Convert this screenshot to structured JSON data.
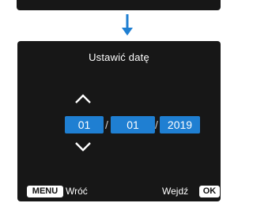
{
  "colors": {
    "screen_bg": "#171717",
    "accent": "#1f7fd2",
    "arrow": "#1f7fd2"
  },
  "icons": {
    "flow_arrow": "arrow-down-icon",
    "increase": "chevron-up-icon",
    "decrease": "chevron-down-icon"
  },
  "screen": {
    "title": "Ustawić datę",
    "date": {
      "day": "01",
      "month": "01",
      "year": "2019",
      "separator": "/"
    },
    "footer": {
      "menu_key": "MENU",
      "menu_label": "Wróć",
      "ok_label": "Wejdź",
      "ok_key": "OK"
    }
  }
}
